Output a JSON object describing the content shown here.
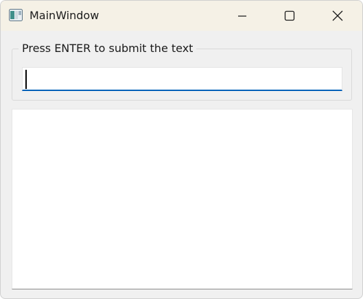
{
  "window": {
    "title": "MainWindow",
    "icons": {
      "app": "app-window-icon",
      "minimize": "minimize-icon",
      "maximize": "maximize-icon",
      "close": "close-icon"
    }
  },
  "form": {
    "group_title": "Press ENTER to submit the text",
    "input_value": "",
    "output_text": ""
  },
  "colors": {
    "titlebar": "#f5f1e6",
    "window_bg": "#f0f0f0",
    "accent": "#005fb8"
  }
}
